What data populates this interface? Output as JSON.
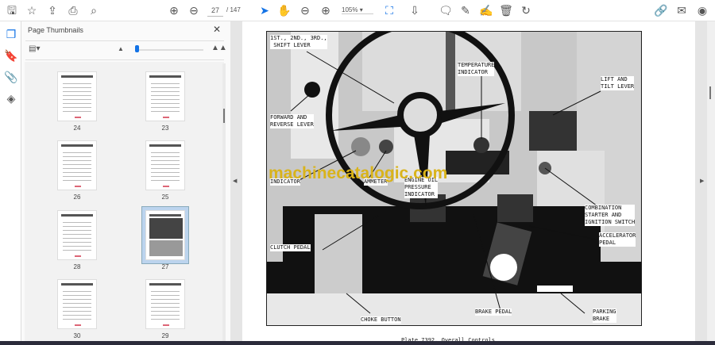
{
  "toolbar": {
    "page_current": "27",
    "page_total": "/ 147",
    "zoom": "105%",
    "icons": [
      "save-icon",
      "star-icon",
      "upload-icon",
      "print-icon",
      "search-icon",
      "page-up-icon",
      "page-down-icon",
      "select-icon",
      "hand-icon",
      "zoom-out-icon",
      "zoom-in-icon",
      "fit-page-icon",
      "scroll-mode-icon",
      "comment-icon",
      "pen-icon",
      "sign-icon",
      "delete-icon",
      "rotate-icon",
      "share-link-icon",
      "email-icon",
      "account-icon"
    ]
  },
  "panel": {
    "title": "Page Thumbnails",
    "close": "✕"
  },
  "thumbnails": [
    {
      "label": "24"
    },
    {
      "label": "23"
    },
    {
      "label": "26"
    },
    {
      "label": "25"
    },
    {
      "label": "28"
    },
    {
      "label": "27",
      "selected": true
    },
    {
      "label": "30"
    },
    {
      "label": "29"
    }
  ],
  "document": {
    "labels": {
      "shift": "1ST., 2ND., 3RD.,\n SHIFT LEVER",
      "temp": "TEMPERATURE\nINDICATOR",
      "lift": "LIFT AND\nTILT LEVER",
      "fwd": "FORWARD AND\nREVERSE LEVER",
      "indicator": "INDICATOR",
      "ammeter": "AMMETER",
      "oil": "ENGINE OIL\nPRESSURE\nINDICATOR",
      "combo": "COMBINATION\nSTARTER AND\nIGNITION SWITCH",
      "accel": "ACCELERATOR\nPEDAL",
      "clutch": "CLUTCH PEDAL",
      "choke": "CHOKE BUTTON",
      "brake": "BRAKE PEDAL",
      "parking": "PARKING\nBRAKE"
    },
    "watermark": "machinecatalogic.com",
    "caption": "Plate 7392. Overall Controls"
  }
}
